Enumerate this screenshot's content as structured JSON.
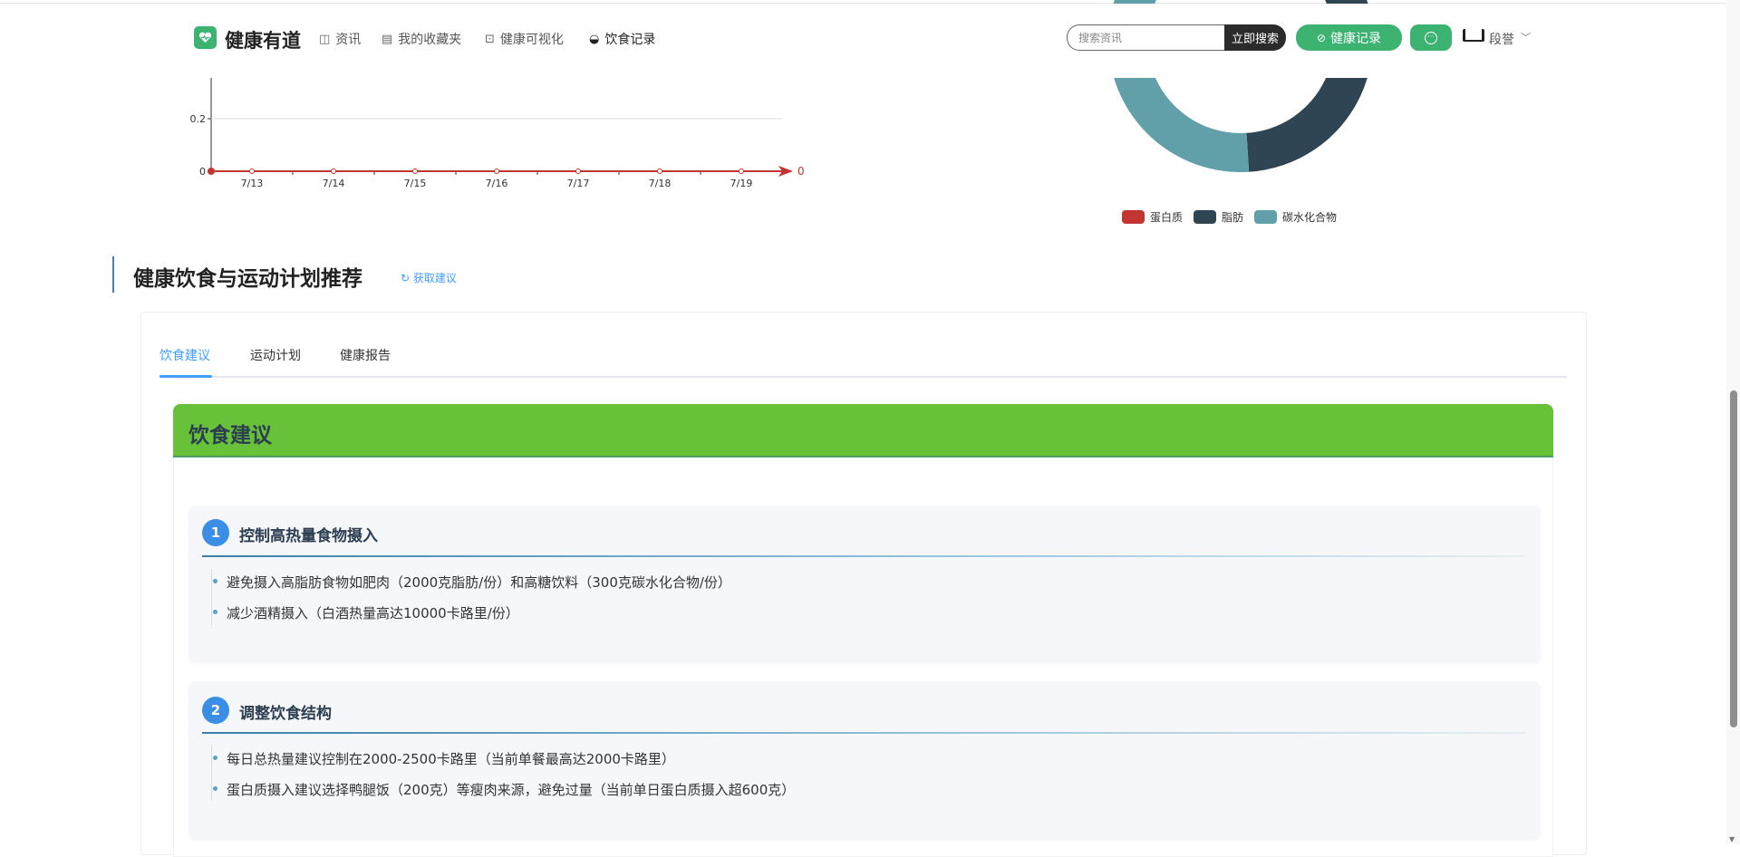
{
  "header": {
    "brand": "健康有道",
    "nav": [
      {
        "label": "资讯",
        "icon": "book-icon"
      },
      {
        "label": "我的收藏夹",
        "icon": "folder-icon"
      },
      {
        "label": "健康可视化",
        "icon": "chart-icon"
      },
      {
        "label": "饮食记录",
        "icon": "bowl-icon"
      }
    ],
    "search_placeholder": "搜索资讯",
    "search_button": "立即搜索",
    "record_button": "健康记录",
    "username": "段誉"
  },
  "chart_data": [
    {
      "type": "line",
      "categories": [
        "7/13",
        "7/14",
        "7/15",
        "7/16",
        "7/17",
        "7/18",
        "7/19"
      ],
      "values": [
        0,
        0,
        0,
        0,
        0,
        0,
        0
      ],
      "yticks": [
        "0",
        "0.2"
      ],
      "ylim": [
        0,
        0.2
      ],
      "end_label": "0",
      "color": "#c23531",
      "grid": true
    },
    {
      "type": "pie",
      "donut": true,
      "legend_position": "bottom",
      "slices": [
        {
          "name": "蛋白质",
          "value": 15,
          "color": "#c23531"
        },
        {
          "name": "脂肪",
          "value": 34,
          "color": "#2f4554"
        },
        {
          "name": "碳水化合物",
          "value": 51,
          "color": "#61a0a8"
        }
      ]
    }
  ],
  "section": {
    "title": "健康饮食与运动计划推荐",
    "refresh_label": "获取建议",
    "tabs": [
      "饮食建议",
      "运动计划",
      "健康报告"
    ],
    "active_tab": 0,
    "panel_title": "饮食建议",
    "items": [
      {
        "num": "1",
        "title": "控制高热量食物摄入",
        "points": [
          "避免摄入高脂肪食物如肥肉（2000克脂肪/份）和高糖饮料（300克碳水化合物/份）",
          "减少酒精摄入（白酒热量高达10000卡路里/份）"
        ]
      },
      {
        "num": "2",
        "title": "调整饮食结构",
        "points": [
          "每日总热量建议控制在2000-2500卡路里（当前单餐最高达2000卡路里）",
          "蛋白质摄入建议选择鸭腿饭（200克）等瘦肉来源，避免过量（当前单日蛋白质摄入超600克）"
        ]
      }
    ]
  }
}
